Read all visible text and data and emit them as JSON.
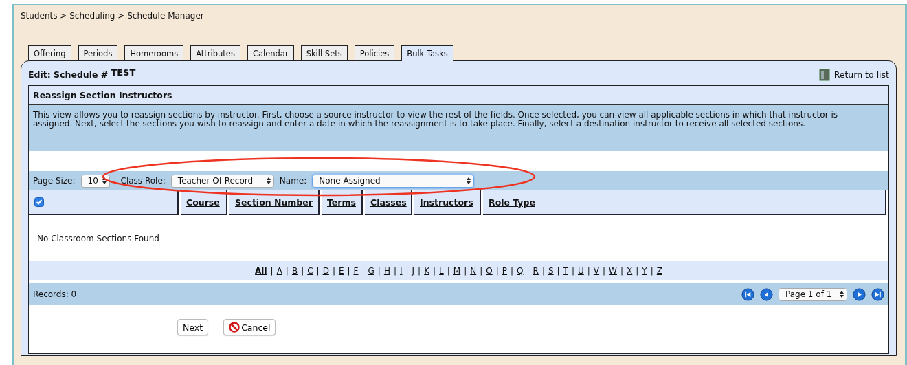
{
  "breadcrumb": "Students > Scheduling > Schedule Manager",
  "tabs": [
    {
      "label": "Offering",
      "selected": false
    },
    {
      "label": "Periods",
      "selected": false
    },
    {
      "label": "Homerooms",
      "selected": false
    },
    {
      "label": "Attributes",
      "selected": false
    },
    {
      "label": "Calendar",
      "selected": false
    },
    {
      "label": "Skill Sets",
      "selected": false
    },
    {
      "label": "Policies",
      "selected": false
    },
    {
      "label": "Bulk Tasks",
      "selected": true
    }
  ],
  "panel": {
    "title": "Edit: Schedule #",
    "schedule": "TEST",
    "return_link": "Return to list"
  },
  "section": {
    "title": "Reassign Section Instructors",
    "description": "This view allows you to reassign sections by instructor. First, choose a source instructor to view the rest of the fields. Once selected, you can view all applicable sections in which that instructor is assigned. Next, select the sections you wish to reassign and enter a date in which the reassignment is to take place. Finally, select a destination instructor to receive all selected sections."
  },
  "filters": {
    "page_size_label": "Page Size:",
    "page_size": "10",
    "class_role_label": "Class Role:",
    "class_role": "Teacher Of Record",
    "name_label": "Name:",
    "name": "None Assigned"
  },
  "table": {
    "select_all_checked": true,
    "columns": [
      "Course",
      "Section Number",
      "Terms",
      "Classes",
      "Instructors",
      "Role Type"
    ],
    "empty_message": "No Classroom Sections Found"
  },
  "alphabet": {
    "separator": "|",
    "letters": [
      {
        "label": "All",
        "selected": true
      },
      {
        "label": "A",
        "selected": false
      },
      {
        "label": "B",
        "selected": false
      },
      {
        "label": "C",
        "selected": false
      },
      {
        "label": "D",
        "selected": false
      },
      {
        "label": "E",
        "selected": false
      },
      {
        "label": "F",
        "selected": false
      },
      {
        "label": "G",
        "selected": false
      },
      {
        "label": "H",
        "selected": false
      },
      {
        "label": "I",
        "selected": false
      },
      {
        "label": "J",
        "selected": false
      },
      {
        "label": "K",
        "selected": false
      },
      {
        "label": "L",
        "selected": false
      },
      {
        "label": "M",
        "selected": false
      },
      {
        "label": "N",
        "selected": false
      },
      {
        "label": "O",
        "selected": false
      },
      {
        "label": "P",
        "selected": false
      },
      {
        "label": "Q",
        "selected": false
      },
      {
        "label": "R",
        "selected": false
      },
      {
        "label": "S",
        "selected": false
      },
      {
        "label": "T",
        "selected": false
      },
      {
        "label": "U",
        "selected": false
      },
      {
        "label": "V",
        "selected": false
      },
      {
        "label": "W",
        "selected": false
      },
      {
        "label": "X",
        "selected": false
      },
      {
        "label": "Y",
        "selected": false
      },
      {
        "label": "Z",
        "selected": false
      }
    ]
  },
  "footer": {
    "records": "Records: 0",
    "page": "Page 1 of 1"
  },
  "buttons": [
    {
      "label": "Next",
      "kind": "plain"
    },
    {
      "label": "Cancel",
      "kind": "cancel"
    }
  ]
}
